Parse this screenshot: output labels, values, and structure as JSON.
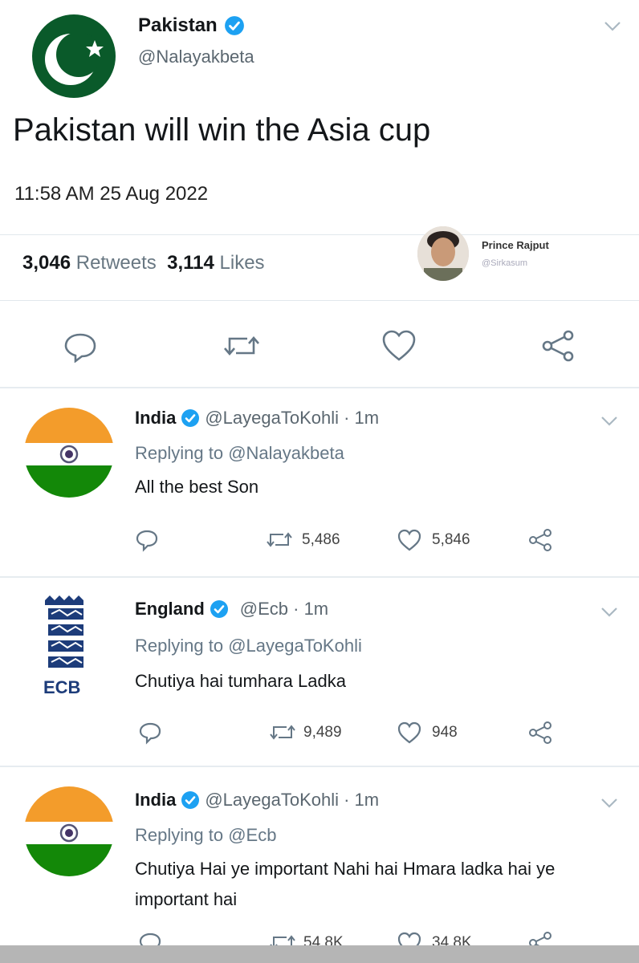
{
  "main_tweet": {
    "name": "Pakistan",
    "handle": "@Nalayakbeta",
    "text": "Pakistan will win the Asia cup",
    "timestamp": "11:58 AM  25 Aug 2022",
    "retweets": "3,046",
    "retweets_label": "Retweets",
    "likes": "3,114",
    "likes_label": "Likes",
    "avatar_colors": {
      "field": "#0a5a2a",
      "symbol": "#ffffff"
    }
  },
  "overlay": {
    "name": "Prince Rajput",
    "handle": "@Sirkasum"
  },
  "replies": [
    {
      "name": "India",
      "handle": "@LayegaToKohli · 1m",
      "replying_prefix": "Replying to ",
      "replying_to": "@Nalayakbeta",
      "text": "All the best Son",
      "retweets": "5,486",
      "likes": "5,846",
      "avatar": "india-flag"
    },
    {
      "name": "England",
      "handle": "@Ecb · 1m",
      "replying_prefix": "Replying to ",
      "replying_to": "@LayegaToKohli",
      "text": "Chutiya hai tumhara Ladka",
      "retweets": "9,489",
      "likes": "948",
      "avatar": "ecb-logo"
    },
    {
      "name": "India",
      "handle": "@LayegaToKohli · 1m",
      "replying_prefix": "Replying to ",
      "replying_to": "@Ecb",
      "text": "Chutiya Hai ye important Nahi hai Hmara ladka hai ye important hai",
      "retweets": "54.8K",
      "likes": "34.8K",
      "avatar": "india-flag"
    }
  ],
  "colors": {
    "verified": "#1da1f2",
    "saffron": "#f39c2b",
    "india_green": "#138808",
    "chakra": "#000080",
    "muted": "#657786"
  }
}
